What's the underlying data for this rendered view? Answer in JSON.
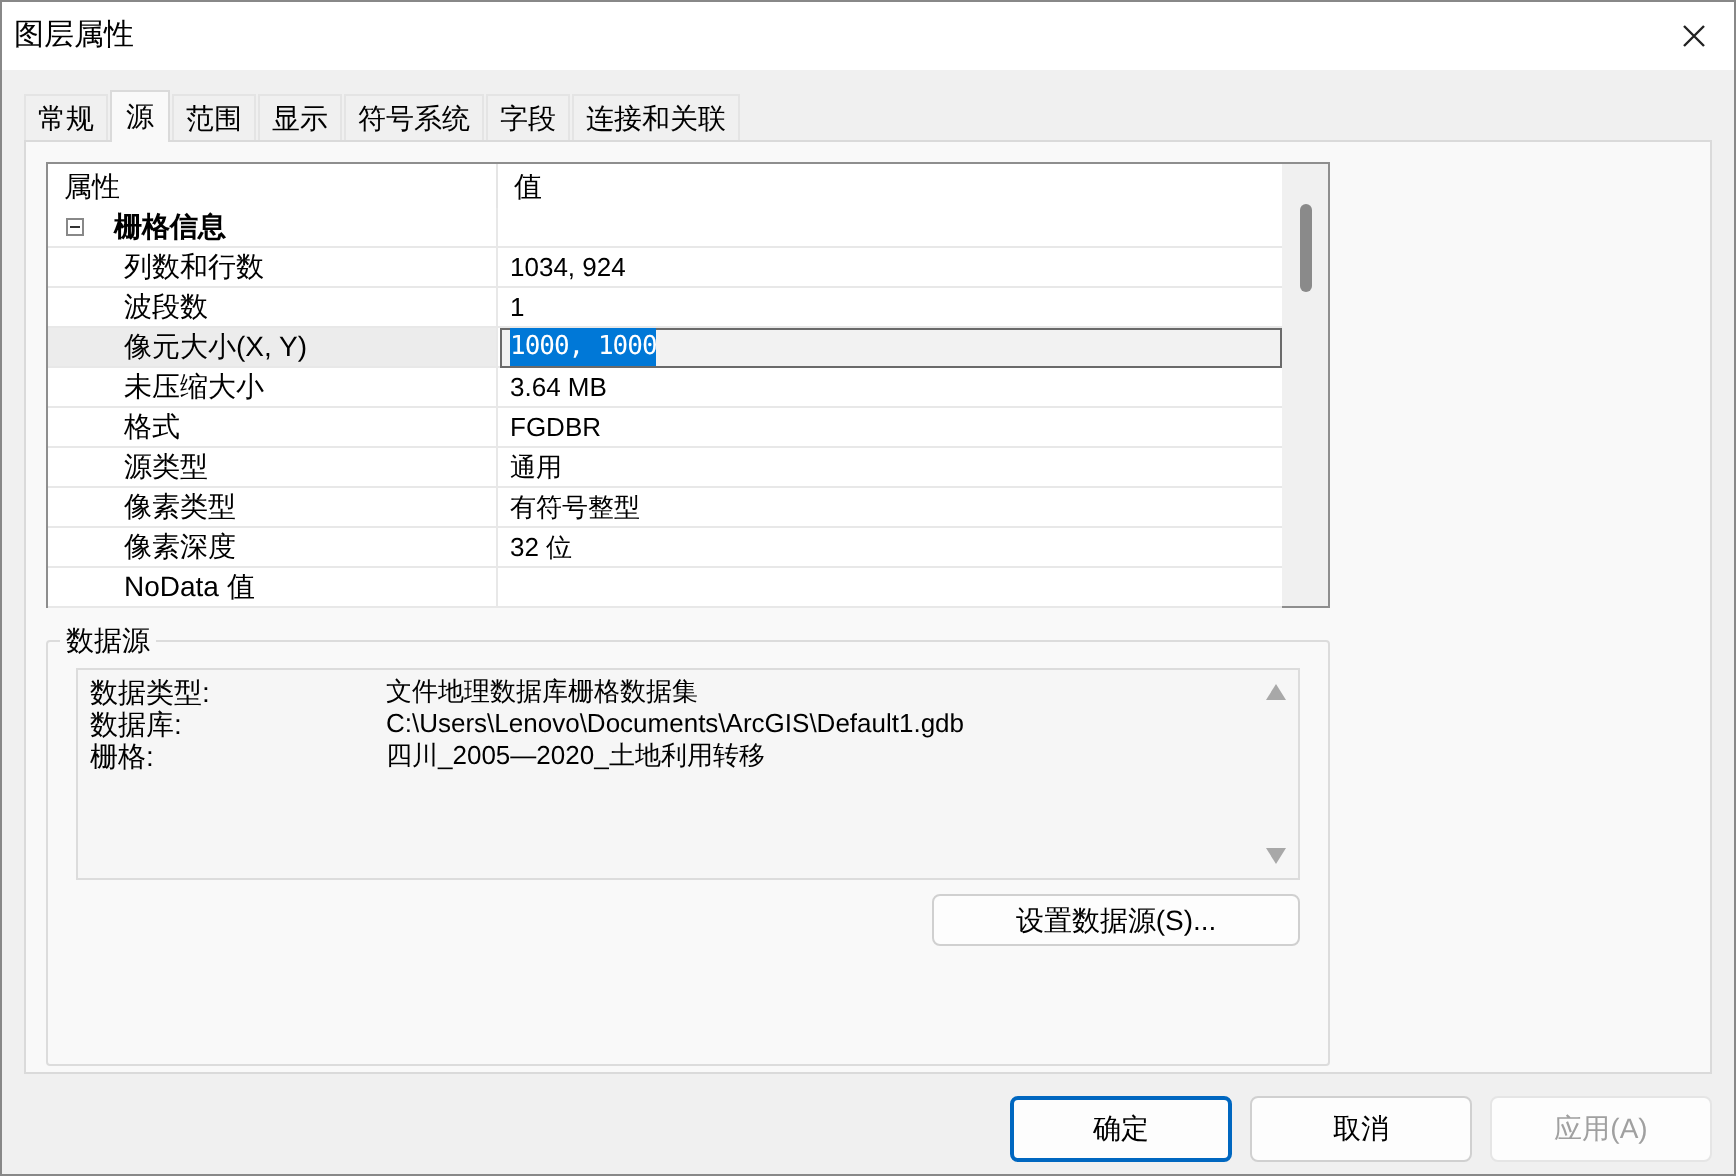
{
  "window": {
    "title": "图层属性"
  },
  "tabs": [
    {
      "label": "常规",
      "selected": false
    },
    {
      "label": "源",
      "selected": true
    },
    {
      "label": "范围",
      "selected": false
    },
    {
      "label": "显示",
      "selected": false
    },
    {
      "label": "符号系统",
      "selected": false
    },
    {
      "label": "字段",
      "selected": false
    },
    {
      "label": "连接和关联",
      "selected": false
    }
  ],
  "property_grid": {
    "columns": [
      "属性",
      "值"
    ],
    "category": {
      "label": "栅格信息",
      "expanded": true,
      "rows": [
        {
          "name": "列数和行数",
          "value": "1034, 924",
          "selected": false
        },
        {
          "name": "波段数",
          "value": "1",
          "selected": false
        },
        {
          "name": "像元大小(X, Y)",
          "value": "1000, 1000",
          "selected": true
        },
        {
          "name": "未压缩大小",
          "value": "3.64 MB",
          "selected": false
        },
        {
          "name": "格式",
          "value": "FGDBR",
          "selected": false
        },
        {
          "name": "源类型",
          "value": "通用",
          "selected": false
        },
        {
          "name": "像素类型",
          "value": "有符号整型",
          "selected": false
        },
        {
          "name": "像素深度",
          "value": "32 位",
          "selected": false
        },
        {
          "name": "NoData 值",
          "value": "",
          "selected": false
        }
      ]
    }
  },
  "data_source": {
    "title": "数据源",
    "rows": [
      {
        "label": "数据类型:",
        "value": "文件地理数据库栅格数据集"
      },
      {
        "label": "数据库:",
        "value": "C:\\Users\\Lenovo\\Documents\\ArcGIS\\Default1.gdb"
      },
      {
        "label": "栅格:",
        "value": "四川_2005—2020_土地利用转移"
      }
    ],
    "button": "设置数据源(S)..."
  },
  "buttons": [
    {
      "label": "确定",
      "default": true,
      "disabled": false
    },
    {
      "label": "取消",
      "default": false,
      "disabled": false
    },
    {
      "label": "应用(A)",
      "default": false,
      "disabled": true
    }
  ]
}
